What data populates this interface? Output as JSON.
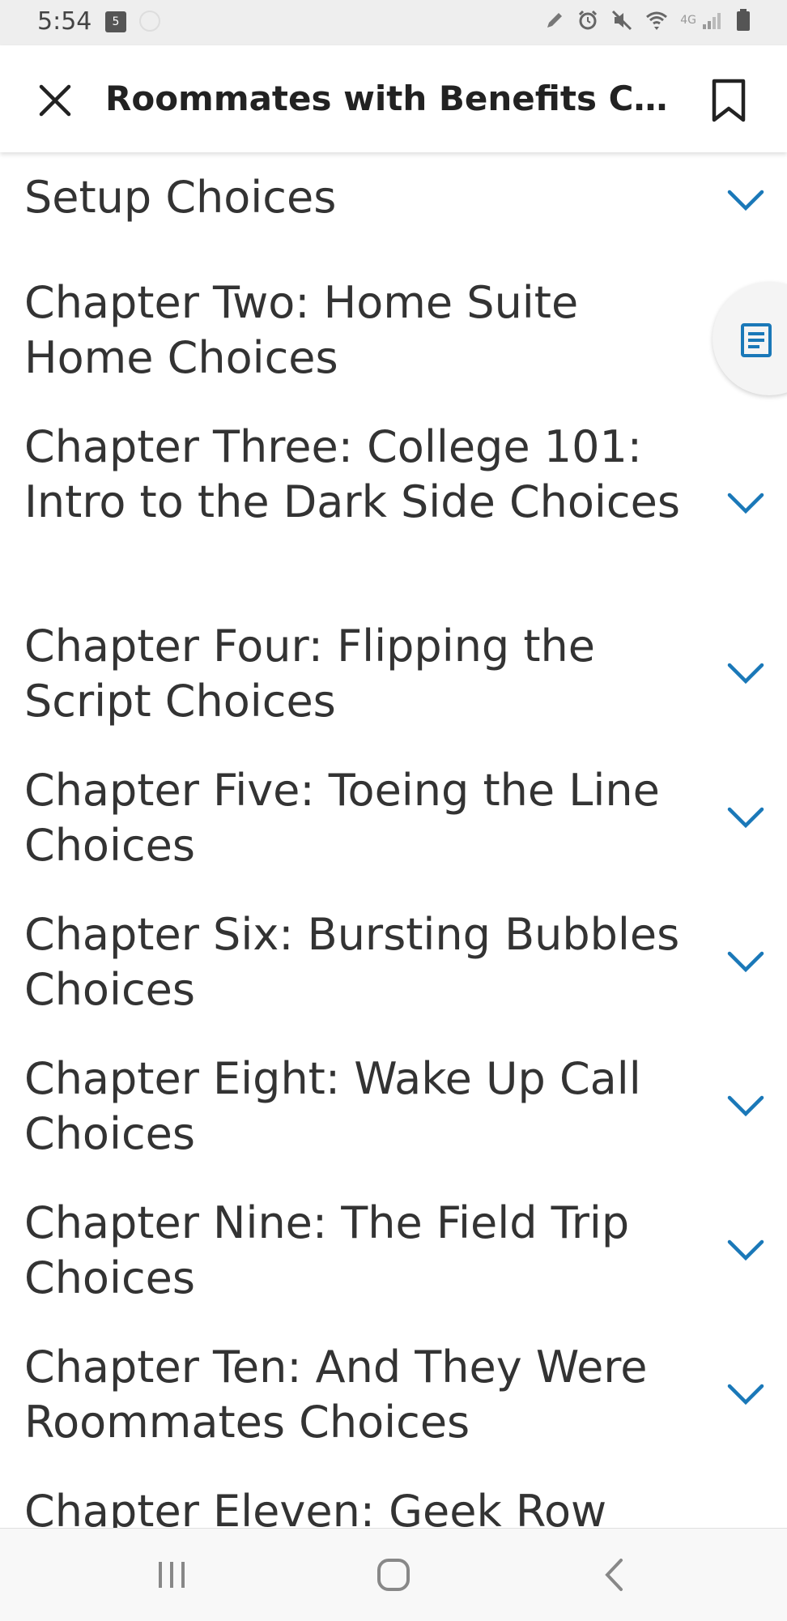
{
  "status_bar": {
    "time": "5:54",
    "notification_badge": "5",
    "network_label": "4G",
    "icons": [
      "pen-icon",
      "alarm-icon",
      "mute-icon",
      "wifi-icon",
      "signal-icon",
      "battery-icon"
    ]
  },
  "app_bar": {
    "title": "Roommates with Benefits Choices",
    "close_icon": "close-icon",
    "bookmark_icon": "bookmark-icon"
  },
  "toc": {
    "accent_color": "#1a78b8",
    "items": [
      {
        "label": "Setup Choices",
        "expandable": true
      },
      {
        "label": "Chapter Two: Home Suite Home Choices",
        "expandable": false
      },
      {
        "label": "Chapter Three: College 101: Intro to the Dark Side Choices",
        "expandable": true
      },
      {
        "label": "Chapter Four: Flipping the Script Choices",
        "expandable": true
      },
      {
        "label": "Chapter Five: Toeing the Line Choices",
        "expandable": true
      },
      {
        "label": "Chapter Six: Bursting Bubbles Choices",
        "expandable": true
      },
      {
        "label": "Chapter Eight: Wake Up Call Choices",
        "expandable": true
      },
      {
        "label": "Chapter Nine: The Field Trip Choices",
        "expandable": true
      },
      {
        "label": "Chapter Ten: And They Were Roommates Choices",
        "expandable": true
      },
      {
        "label": "Chapter Eleven: Geek Row",
        "expandable": true
      }
    ]
  },
  "fab": {
    "icon": "table-of-contents-icon"
  },
  "nav_bar": {
    "icons": [
      "recent-apps-icon",
      "home-icon",
      "back-icon"
    ]
  }
}
